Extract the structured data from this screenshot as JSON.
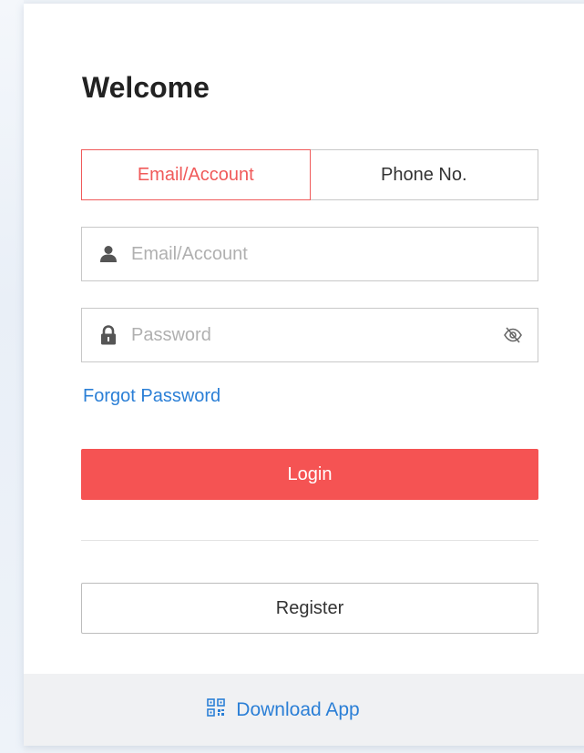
{
  "login": {
    "title": "Welcome",
    "tabs": [
      {
        "label": "Email/Account",
        "active": true
      },
      {
        "label": "Phone No.",
        "active": false
      }
    ],
    "account_field": {
      "placeholder": "Email/Account",
      "value": "",
      "icon": "user-icon"
    },
    "password_field": {
      "placeholder": "Password",
      "value": "",
      "icon": "lock-icon",
      "toggle_icon": "eye-slash-icon"
    },
    "forgot_label": "Forgot Password",
    "login_label": "Login",
    "register_label": "Register"
  },
  "footer": {
    "download_label": "Download App",
    "icon": "qr-code-icon"
  },
  "colors": {
    "accent": "#f55353",
    "link": "#2b7fd6",
    "border": "#c8c8c8"
  }
}
